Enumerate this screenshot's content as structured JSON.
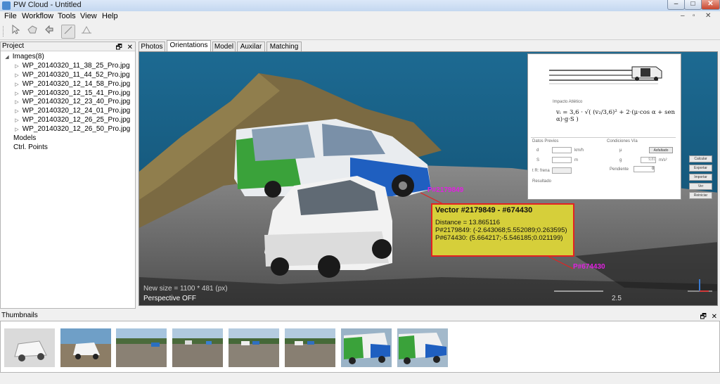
{
  "window": {
    "title": "PW Cloud - Untitled",
    "min": "–",
    "max": "□",
    "close": "✕"
  },
  "menu": {
    "items": [
      "File",
      "Workflow",
      "Tools",
      "View",
      "Help"
    ]
  },
  "mdi_controls": {
    "min": "–",
    "restore": "▫",
    "close": "✕"
  },
  "toolbar": {
    "icons": [
      "arrow-icon",
      "hand-icon",
      "rotate-icon",
      "select-rect-icon",
      "measure-icon"
    ]
  },
  "project": {
    "title": "Project",
    "float_icon": "🗗",
    "close_icon": "✕",
    "images_label": "Images(8)",
    "images": [
      "WP_20140320_11_38_25_Pro.jpg",
      "WP_20140320_11_44_52_Pro.jpg",
      "WP_20140320_12_14_58_Pro.jpg",
      "WP_20140320_12_15_41_Pro.jpg",
      "WP_20140320_12_23_40_Pro.jpg",
      "WP_20140320_12_24_01_Pro.jpg",
      "WP_20140320_12_26_25_Pro.jpg",
      "WP_20140320_12_26_50_Pro.jpg"
    ],
    "models_label": "Models",
    "ctrl_points_label": "Ctrl. Points"
  },
  "tabs": [
    "Photos",
    "Orientations",
    "Model",
    "Auxilar",
    "Matching"
  ],
  "active_tab": "Orientations",
  "viewport": {
    "new_size": "New size = 1100 * 481 (px)",
    "perspective": "Perspective OFF",
    "scale_label": "2.5",
    "point_a": "P#2179849",
    "point_b": "P#674430"
  },
  "vector_popup": {
    "title": "Vector #2179849 - #674430",
    "distance": "Distance = 13.865116",
    "p1": "P#2179849: (-2.643068;5.552089;0.263595)",
    "p2": "P#674430: (5.664217;-5.546185;0.021199)"
  },
  "calculator": {
    "formula_title": "Impacto Atlético",
    "formula": "vᵢ = 3,6 · √( (v₂/3,6)² + 2·(μ·cos α + sen α)·g·S )",
    "section_left": "Datos Previos",
    "section_right": "Condiciones Vía",
    "field_d": "d",
    "field_s": "S",
    "field_tr": "t R: frena",
    "unit_kmh": "km/h",
    "unit_m": "m",
    "field_mu": "μ",
    "mu_button": "Asfaltado",
    "field_g": "g",
    "g_value": "9,81",
    "g_unit": "m/s²",
    "pendiente": "Pendiente",
    "pendiente_value": "0",
    "resultado": "Resultado",
    "side_buttons": [
      "Calcular",
      "Exportar",
      "Importar",
      "Ver",
      "Reiniciar"
    ]
  },
  "thumbnails": {
    "title": "Thumbnails",
    "count": 8
  },
  "colors": {
    "popup_bg": "#d6cf3a",
    "popup_border": "#e32222",
    "point_label": "#e020e0",
    "sky": "#1f6a8f"
  }
}
